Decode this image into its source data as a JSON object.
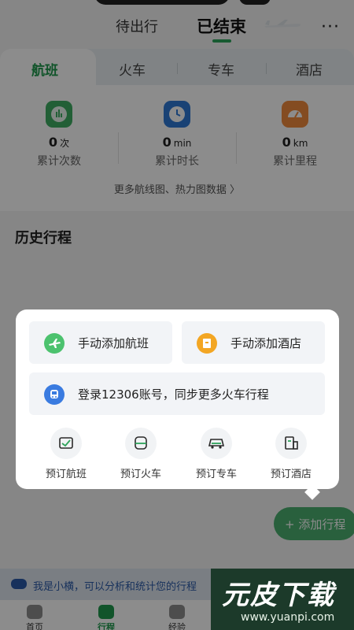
{
  "header": {
    "tab_pending": "待出行",
    "tab_done": "已结束",
    "more_icon": "more-icon",
    "more_label": "···"
  },
  "categories": [
    {
      "label": "航班",
      "active": true
    },
    {
      "label": "火车",
      "active": false
    },
    {
      "label": "专车",
      "active": false
    },
    {
      "label": "酒店",
      "active": false
    }
  ],
  "stats": {
    "items": [
      {
        "value": "0",
        "unit": "次",
        "label": "累计次数",
        "icon": "chart-icon",
        "color": "#3fae63"
      },
      {
        "value": "0",
        "unit": "min",
        "label": "累计时长",
        "icon": "clock-icon",
        "color": "#2f79d6"
      },
      {
        "value": "0",
        "unit": "km",
        "label": "累计里程",
        "icon": "gauge-icon",
        "color": "#f08a3c"
      }
    ],
    "more_link": "更多航线图、热力图数据 〉"
  },
  "history_title": "历史行程",
  "popup": {
    "add_flight": "手动添加航班",
    "add_hotel": "手动添加酒店",
    "login_12306": "登录12306账号，同步更多火车行程",
    "quick": [
      {
        "label": "预订航班",
        "icon": "flight-ticket-icon"
      },
      {
        "label": "预订火车",
        "icon": "train-icon"
      },
      {
        "label": "预订专车",
        "icon": "car-icon"
      },
      {
        "label": "预订酒店",
        "icon": "hotel-icon"
      }
    ]
  },
  "fab_label": "+ 添加行程",
  "assistant_text": "我是小横，可以分析和统计您的行程",
  "tabbar": [
    {
      "label": "首页",
      "active": false
    },
    {
      "label": "行程",
      "active": true
    },
    {
      "label": "经验",
      "active": false
    }
  ],
  "watermark": {
    "title": "元皮下载",
    "url": "www.yuanpi.com"
  },
  "colors": {
    "accent": "#1f9a4e",
    "flight_icon": "#4cc26e",
    "hotel_icon": "#f3a623",
    "train_icon": "#3a7be0"
  }
}
